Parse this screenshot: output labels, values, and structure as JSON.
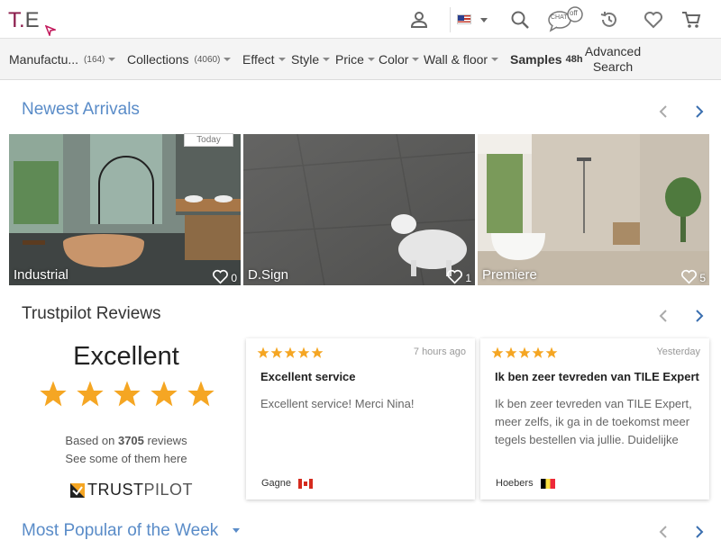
{
  "logo": {
    "text_t": "T",
    "text_dot": ".",
    "text_e": "E"
  },
  "header": {
    "icons": [
      "user-icon",
      "flag-us-icon",
      "search-icon",
      "chat-icon",
      "history-icon",
      "heart-icon",
      "cart-icon"
    ],
    "chat_label": "CHAT",
    "chat_badge": "off"
  },
  "nav": {
    "manufacturers": {
      "label": "Manufactu...",
      "count": "(164)"
    },
    "collections": {
      "label": "Collections",
      "count": "(4060)"
    },
    "effect": "Effect",
    "style": "Style",
    "price": "Price",
    "color": "Color",
    "wall_floor": "Wall & floor",
    "samples": {
      "label": "Samples",
      "sub": "48h"
    },
    "advanced": {
      "line1": "Advanced",
      "line2": "Search"
    }
  },
  "newest": {
    "title": "Newest Arrivals",
    "badge": "Today",
    "tiles": [
      {
        "label": "Industrial",
        "likes": "0"
      },
      {
        "label": "D.Sign",
        "likes": "1"
      },
      {
        "label": "Premiere",
        "likes": "5"
      }
    ]
  },
  "trustpilot": {
    "title": "Trustpilot Reviews",
    "rating_word": "Excellent",
    "based_prefix": "Based on ",
    "review_count": "3705",
    "based_suffix": " reviews",
    "see_more": "See some of them here",
    "brand_1": "TRUST",
    "brand_2": "PILOT",
    "reviews": [
      {
        "time": "7 hours ago",
        "title": "Excellent service",
        "body": "Excellent service! Merci Nina!",
        "user": "Gagne",
        "flag": "CA"
      },
      {
        "time": "Yesterday",
        "title": "Ik ben zeer tevreden van TILE Expert",
        "body": "Ik ben zeer tevreden van TILE Expert, meer zelfs, ik ga in de toekomst meer tegels bestellen via jullie. Duidelijke",
        "user": "Hoebers",
        "flag": "BE"
      }
    ]
  },
  "popular": {
    "title": "Most Popular of the Week"
  },
  "colors": {
    "accent_blue": "#5a8cc8",
    "brand": "#8a1a4a",
    "star_orange": "#f5a623",
    "star_green_card": "#f5a623"
  }
}
